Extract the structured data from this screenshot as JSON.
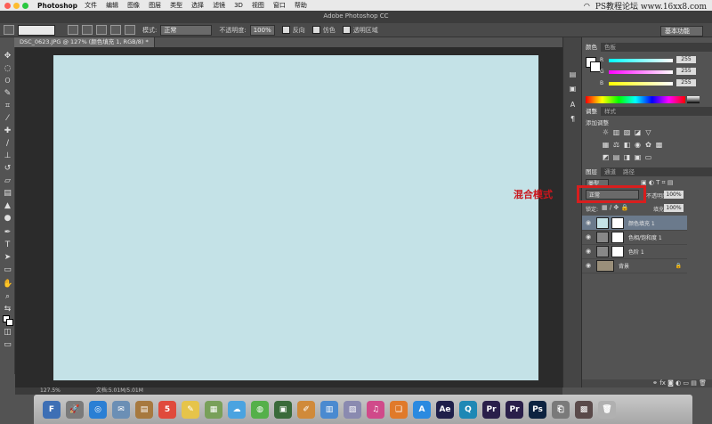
{
  "menubar": {
    "app_name": "Photoshop",
    "menus": [
      "文件",
      "编辑",
      "图像",
      "图层",
      "类型",
      "选择",
      "滤镜",
      "3D",
      "视图",
      "窗口",
      "帮助"
    ],
    "watermark": "PS教程论坛 www.16xx8.com"
  },
  "window": {
    "title": "Adobe Photoshop CC"
  },
  "options_bar": {
    "mode_label": "模式:",
    "mode_value": "正常",
    "opacity_label": "不透明度:",
    "opacity_value": "100%",
    "reverse_label": "反向",
    "dither_label": "仿色",
    "transparency_label": "透明区域",
    "workspace": "基本功能"
  },
  "document_tab": {
    "label": "DSC_0623.JPG @ 127% (颜色填充 1, RGB/8) *"
  },
  "status_bar": {
    "zoom": "127.5%",
    "doc_info": "文档:5.01M/5.01M"
  },
  "color_panel": {
    "tabs": [
      "颜色",
      "色板"
    ],
    "channels": [
      {
        "label": "R",
        "value": "255"
      },
      {
        "label": "G",
        "value": "255"
      },
      {
        "label": "B",
        "value": "255"
      }
    ]
  },
  "adjustments_panel": {
    "tabs": [
      "调整",
      "样式"
    ],
    "heading": "添加调整"
  },
  "layers_panel": {
    "tabs": [
      "图层",
      "通道",
      "路径"
    ],
    "kind_label": "类型",
    "blend_mode": "正常",
    "opacity_label": "不透明度:",
    "opacity_value": "100%",
    "lock_label": "锁定:",
    "fill_label": "填充:",
    "fill_value": "100%",
    "layers": [
      {
        "name": "颜色填充 1",
        "thumb_color": "#c4e2e7",
        "selected": true
      },
      {
        "name": "色相/饱和度 1",
        "thumb_color": "#888888",
        "selected": false
      },
      {
        "name": "色阶 1",
        "thumb_color": "#888888",
        "selected": false
      },
      {
        "name": "背景",
        "thumb_color": "#9a8f7a",
        "selected": false
      }
    ]
  },
  "annotation": {
    "text": "混合模式"
  },
  "dock": {
    "apps": [
      {
        "label": "F",
        "color": "#3d6fb5"
      },
      {
        "label": "🚀",
        "color": "#7a7a7a"
      },
      {
        "label": "◎",
        "color": "#2a7fd4"
      },
      {
        "label": "✉",
        "color": "#6b8fb5"
      },
      {
        "label": "▤",
        "color": "#a7793f"
      },
      {
        "label": "5",
        "color": "#e04a3c"
      },
      {
        "label": "✎",
        "color": "#e6c44a"
      },
      {
        "label": "▦",
        "color": "#79a05a"
      },
      {
        "label": "☁",
        "color": "#4aa3e0"
      },
      {
        "label": "◍",
        "color": "#55b04a"
      },
      {
        "label": "▣",
        "color": "#3a6a3a"
      },
      {
        "label": "✐",
        "color": "#d08a3a"
      },
      {
        "label": "▥",
        "color": "#4a8ad0"
      },
      {
        "label": "▧",
        "color": "#8a8ab0"
      },
      {
        "label": "♫",
        "color": "#d04a8a"
      },
      {
        "label": "❑",
        "color": "#e07a2a"
      },
      {
        "label": "A",
        "color": "#2a8ae0"
      },
      {
        "label": "Ae",
        "color": "#1f1f4a"
      },
      {
        "label": "Q",
        "color": "#1e88b5"
      },
      {
        "label": "Pr",
        "color": "#2a1f4a"
      },
      {
        "label": "Pr",
        "color": "#2a1f4a"
      },
      {
        "label": "Ps",
        "color": "#0d2340"
      },
      {
        "label": "⎗",
        "color": "#7a7a7a"
      },
      {
        "label": "▩",
        "color": "#5a4a4a"
      },
      {
        "label": "🗑",
        "color": "#b0b0b0"
      }
    ]
  }
}
